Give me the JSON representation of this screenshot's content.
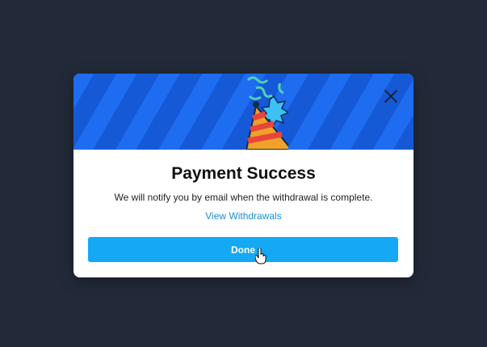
{
  "dialog": {
    "title": "Payment Success",
    "message": "We will notify you by email when the withdrawal is complete.",
    "link_label": "View Withdrawals",
    "done_label": "Done",
    "banner_icon": "party-hat-icon",
    "close_icon": "close-icon"
  },
  "colors": {
    "background": "#222a39",
    "banner_primary": "#1e6cf0",
    "banner_stripe": "#1559d6",
    "accent": "#14a8f5",
    "link": "#1a8fd8"
  }
}
